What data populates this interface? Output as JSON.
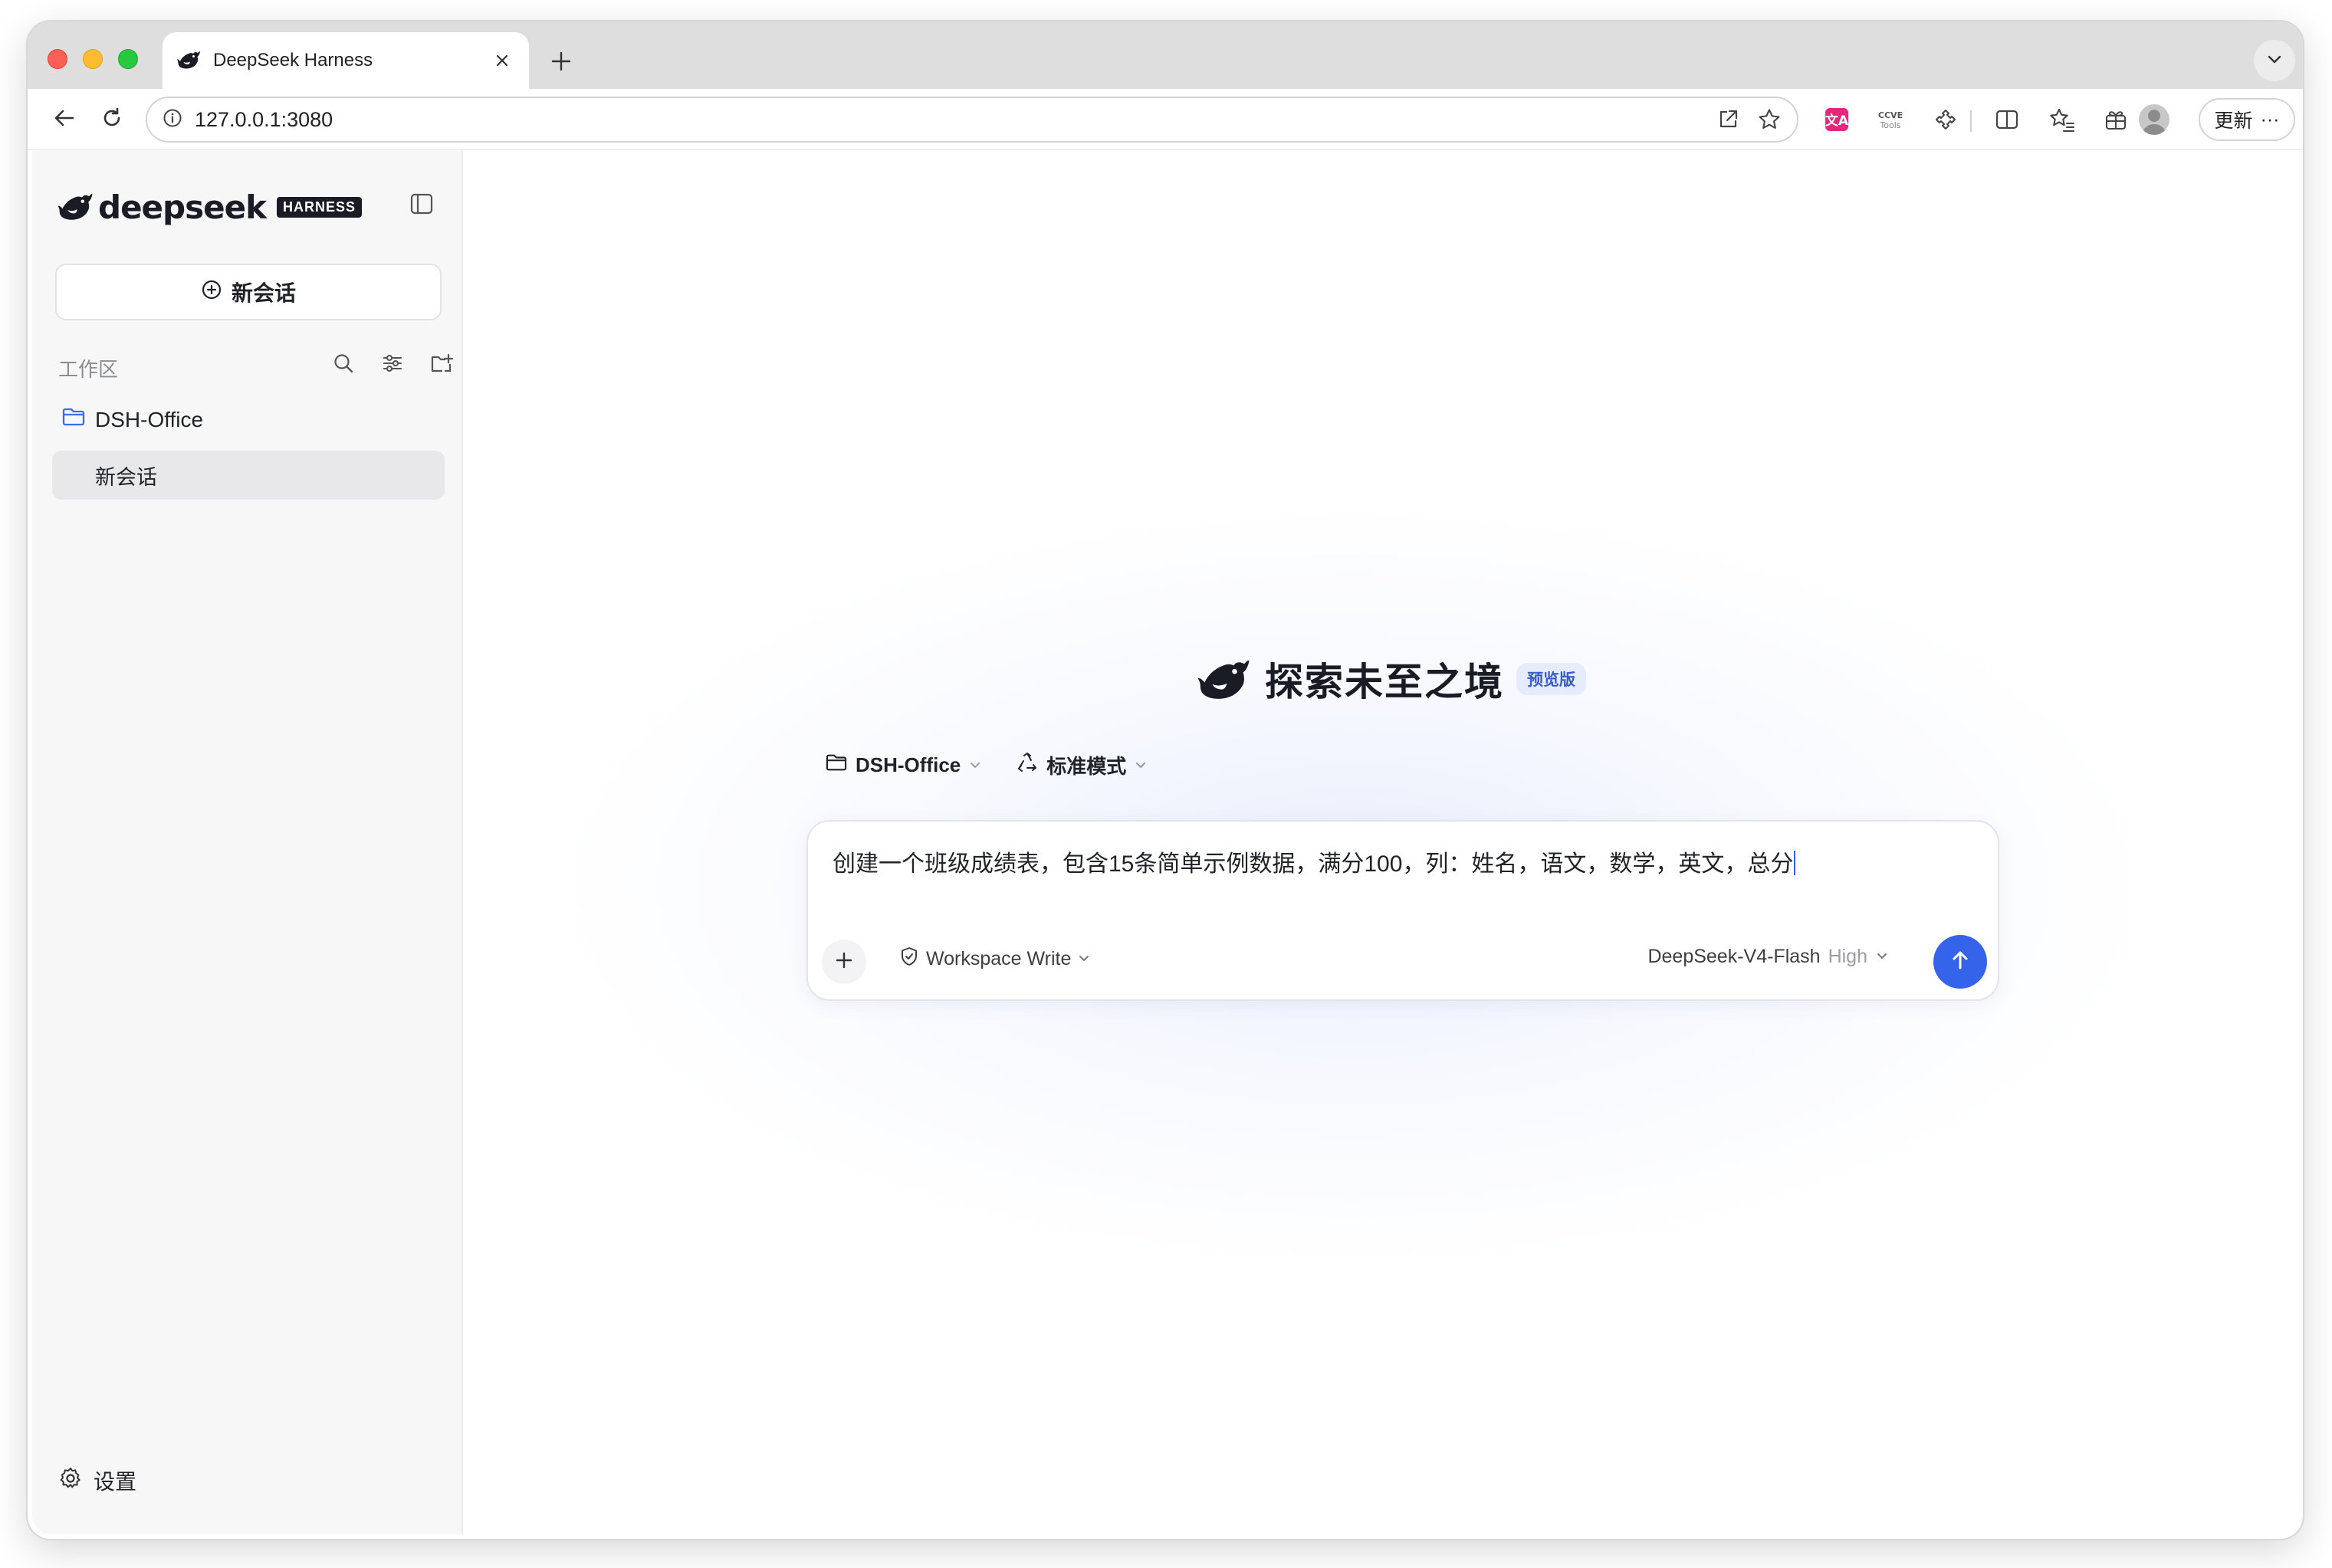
{
  "browser": {
    "tab_title": "DeepSeek Harness",
    "url": "127.0.0.1:3080",
    "update_label": "更新",
    "more_label": "···"
  },
  "sidebar": {
    "brand_word": "deepseek",
    "brand_badge": "HARNESS",
    "new_chat_label": "新会话",
    "workspace_label": "工作区",
    "folder_name": "DSH-Office",
    "chat_item": "新会话",
    "settings_label": "设置"
  },
  "main": {
    "hero_title": "探索未至之境",
    "preview_badge": "预览版",
    "workspace_selector": "DSH-Office",
    "mode_selector": "标准模式",
    "composer_text": "创建一个班级成绩表，包含15条简单示例数据，满分100，列：姓名，语文，数学，英文，总分",
    "permission_label": "Workspace Write",
    "model_name": "DeepSeek-V4-Flash",
    "model_level": "High"
  },
  "colors": {
    "accent": "#3563e9",
    "preview_badge_bg": "#e5ecfd",
    "folder_icon": "#3b6fe0",
    "sidebar_bg": "#f7f7f8"
  },
  "icons": [
    "deepseek-whale-icon",
    "close-icon",
    "plus-icon",
    "chevron-down-icon",
    "back-arrow-icon",
    "reload-icon",
    "info-icon",
    "share-icon",
    "star-icon",
    "translate-extension-icon",
    "devtools-extension-icon",
    "puzzle-extension-icon",
    "split-view-icon",
    "favorites-icon",
    "collections-icon",
    "sidebar-toggle-icon",
    "new-chat-icon",
    "search-icon",
    "sliders-icon",
    "new-folder-icon",
    "folder-icon",
    "gear-icon",
    "recycle-mode-icon",
    "shield-icon",
    "send-arrow-icon"
  ]
}
